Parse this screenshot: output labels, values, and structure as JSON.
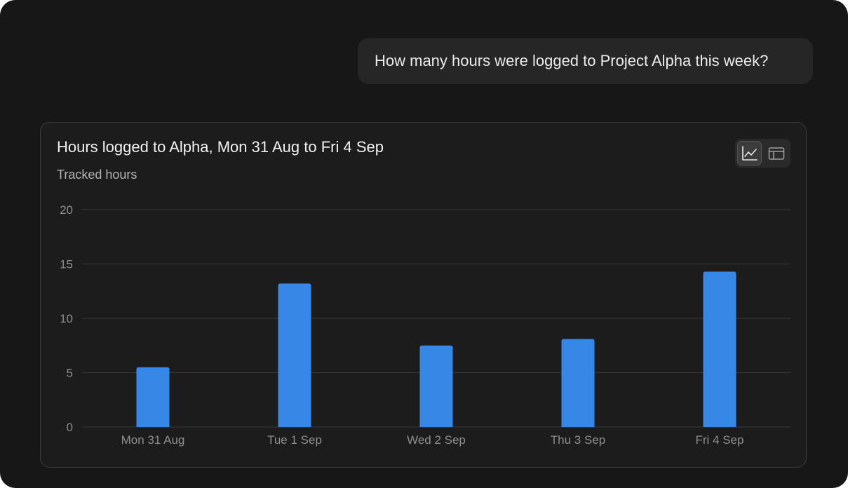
{
  "conversation": {
    "user_message": "How many hours were logged to Project Alpha this week?"
  },
  "card": {
    "title": "Hours logged to Alpha, Mon 31 Aug to Fri 4 Sep",
    "subtitle": "Tracked hours"
  },
  "view_toggle": {
    "options": [
      {
        "icon": "chart-icon",
        "selected": true
      },
      {
        "icon": "table-icon",
        "selected": false
      }
    ]
  },
  "colors": {
    "background": "#171717",
    "card": "#1c1c1c",
    "bar": "#3787e6",
    "grid": "#3a3a3a"
  },
  "chart_data": {
    "type": "bar",
    "title": "Hours logged to Alpha, Mon 31 Aug to Fri 4 Sep",
    "ylabel": "Tracked hours",
    "xlabel": "",
    "categories": [
      "Mon 31 Aug",
      "Tue 1 Sep",
      "Wed 2 Sep",
      "Thu 3 Sep",
      "Fri 4 Sep"
    ],
    "values": [
      5.5,
      13.2,
      7.5,
      8.1,
      14.3
    ],
    "ylim": [
      0,
      20
    ],
    "yticks": [
      0,
      5,
      10,
      15,
      20
    ],
    "grid": true,
    "legend": "none"
  }
}
